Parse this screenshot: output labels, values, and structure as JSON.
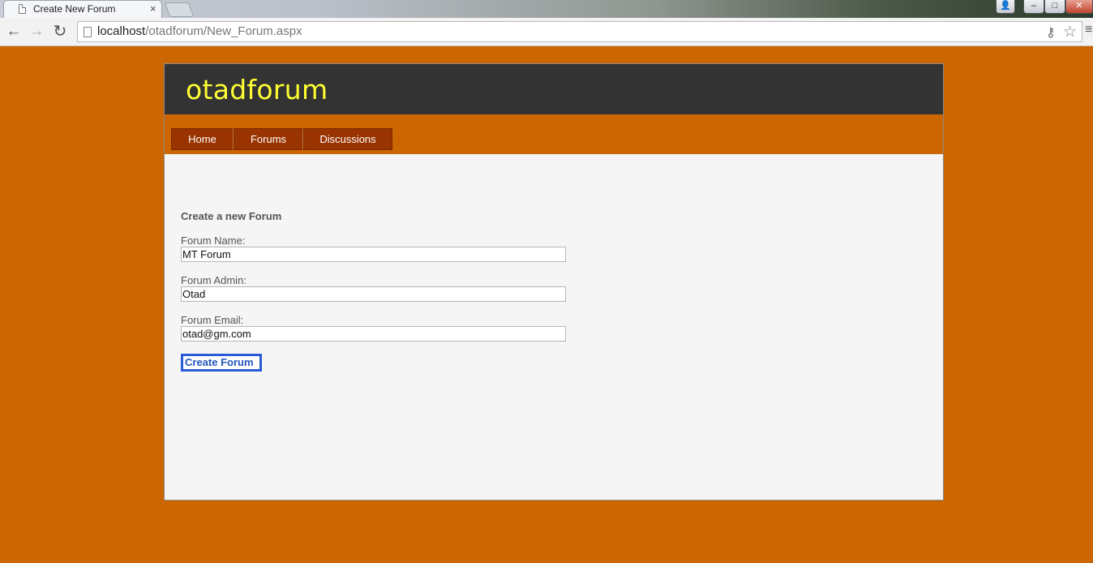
{
  "browser": {
    "tab_title": "Create New Forum",
    "tab_close": "×",
    "url_host": "localhost",
    "url_path": "/otadforum/New_Forum.aspx",
    "window_controls": {
      "user": "👤",
      "minimize": "–",
      "maximize": "□",
      "close": "✕"
    },
    "nav": {
      "back": "←",
      "forward": "→",
      "reload": "↻"
    },
    "icons": {
      "key": "⚷",
      "star": "☆",
      "menu": "≡"
    }
  },
  "site": {
    "title": "otadforum",
    "menu": [
      {
        "label": "Home"
      },
      {
        "label": "Forums"
      },
      {
        "label": "Discussions"
      }
    ]
  },
  "form": {
    "heading": "Create a new Forum",
    "fields": [
      {
        "label": "Forum Name:",
        "value": "MT Forum"
      },
      {
        "label": "Forum Admin:",
        "value": "Otad"
      },
      {
        "label": "Forum Email:",
        "value": "otad@gm.com"
      }
    ],
    "submit_label": "Create Forum"
  },
  "colors": {
    "page_background": "#cc6600",
    "header_background": "#333333",
    "title_color": "#ffff33",
    "menu_item_background": "#993300",
    "content_background": "#f5f5f5",
    "focus_outline": "#2a5bd7"
  }
}
